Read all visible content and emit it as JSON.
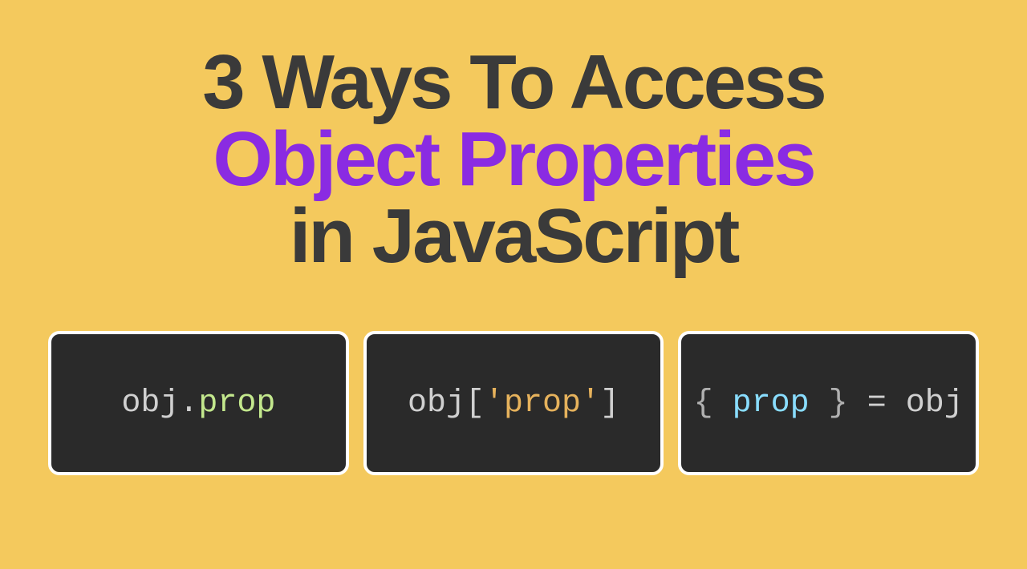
{
  "title": {
    "line1": "3 Ways To Access",
    "line2": "Object Properties",
    "line3": "in JavaScript"
  },
  "examples": {
    "dot": {
      "obj": "obj",
      "dot": ".",
      "prop": "prop"
    },
    "bracket": {
      "obj": "obj",
      "open": "[",
      "string": "'prop'",
      "close": "]"
    },
    "destructure": {
      "open": "{ ",
      "var": "prop",
      "close": " }",
      "eq": " = ",
      "obj": "obj"
    }
  }
}
